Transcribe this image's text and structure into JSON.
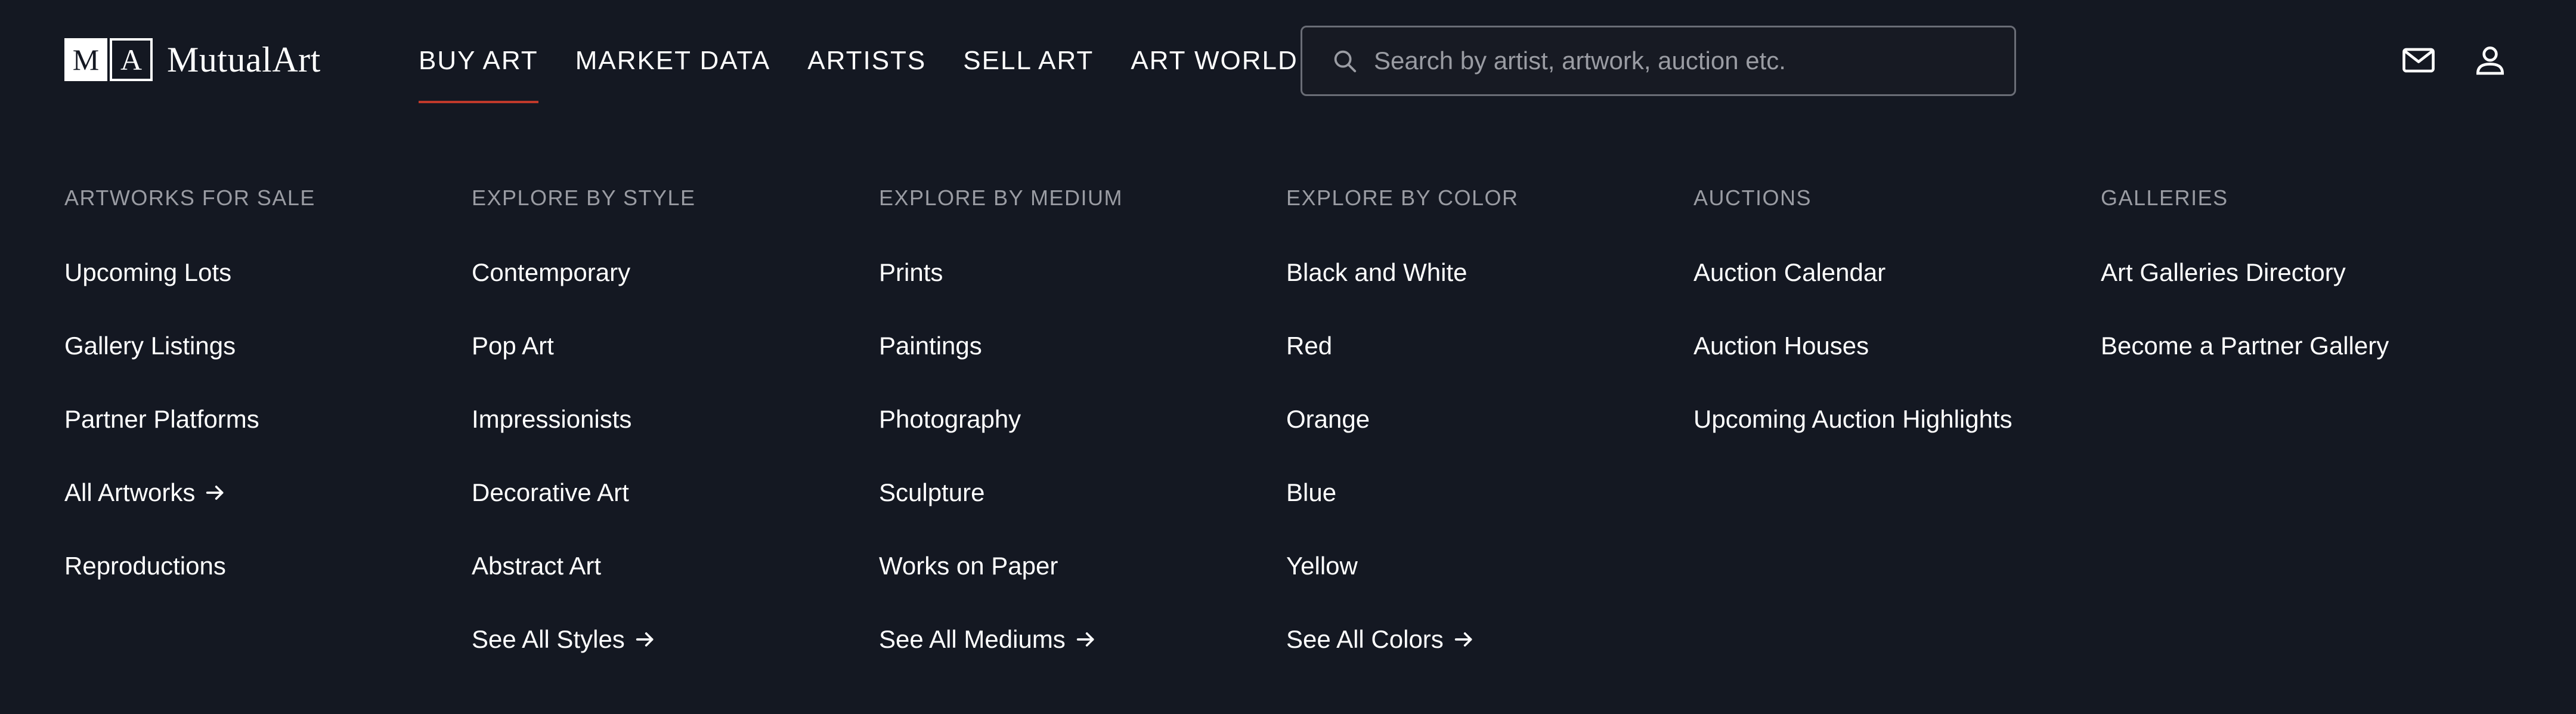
{
  "brand": {
    "logo_letter_1": "M",
    "logo_letter_2": "A",
    "name": "MutualArt"
  },
  "nav": {
    "items": [
      {
        "label": "BUY ART",
        "active": true
      },
      {
        "label": "MARKET DATA",
        "active": false
      },
      {
        "label": "ARTISTS",
        "active": false
      },
      {
        "label": "SELL ART",
        "active": false
      },
      {
        "label": "ART WORLD",
        "active": false
      }
    ]
  },
  "search": {
    "placeholder": "Search by artist, artwork, auction etc.",
    "value": ""
  },
  "header_icons": [
    "mail-icon",
    "user-icon"
  ],
  "colors": {
    "background": "#141822",
    "active_underline": "#c0392b",
    "heading_text": "#9a9ca3",
    "link_text": "#ffffff"
  },
  "menu": {
    "columns": [
      {
        "heading": "ARTWORKS FOR SALE",
        "items": [
          {
            "label": "Upcoming Lots"
          },
          {
            "label": "Gallery Listings"
          },
          {
            "label": "Partner Platforms"
          },
          {
            "label": "All Artworks",
            "arrow": true
          },
          {
            "label": "Reproductions"
          }
        ]
      },
      {
        "heading": "EXPLORE BY STYLE",
        "items": [
          {
            "label": "Contemporary"
          },
          {
            "label": "Pop Art"
          },
          {
            "label": "Impressionists"
          },
          {
            "label": "Decorative Art"
          },
          {
            "label": "Abstract Art"
          },
          {
            "label": "See All Styles",
            "arrow": true
          }
        ]
      },
      {
        "heading": "EXPLORE BY MEDIUM",
        "items": [
          {
            "label": "Prints"
          },
          {
            "label": "Paintings"
          },
          {
            "label": "Photography"
          },
          {
            "label": "Sculpture"
          },
          {
            "label": "Works on Paper"
          },
          {
            "label": "See All Mediums",
            "arrow": true
          }
        ]
      },
      {
        "heading": "EXPLORE BY COLOR",
        "items": [
          {
            "label": "Black and White"
          },
          {
            "label": "Red"
          },
          {
            "label": "Orange"
          },
          {
            "label": "Blue"
          },
          {
            "label": "Yellow"
          },
          {
            "label": "See All Colors",
            "arrow": true
          }
        ]
      },
      {
        "heading": "AUCTIONS",
        "items": [
          {
            "label": "Auction Calendar"
          },
          {
            "label": "Auction Houses"
          },
          {
            "label": "Upcoming Auction Highlights"
          }
        ]
      },
      {
        "heading": "GALLERIES",
        "items": [
          {
            "label": "Art Galleries Directory"
          },
          {
            "label": "Become a Partner Gallery"
          }
        ]
      }
    ]
  }
}
